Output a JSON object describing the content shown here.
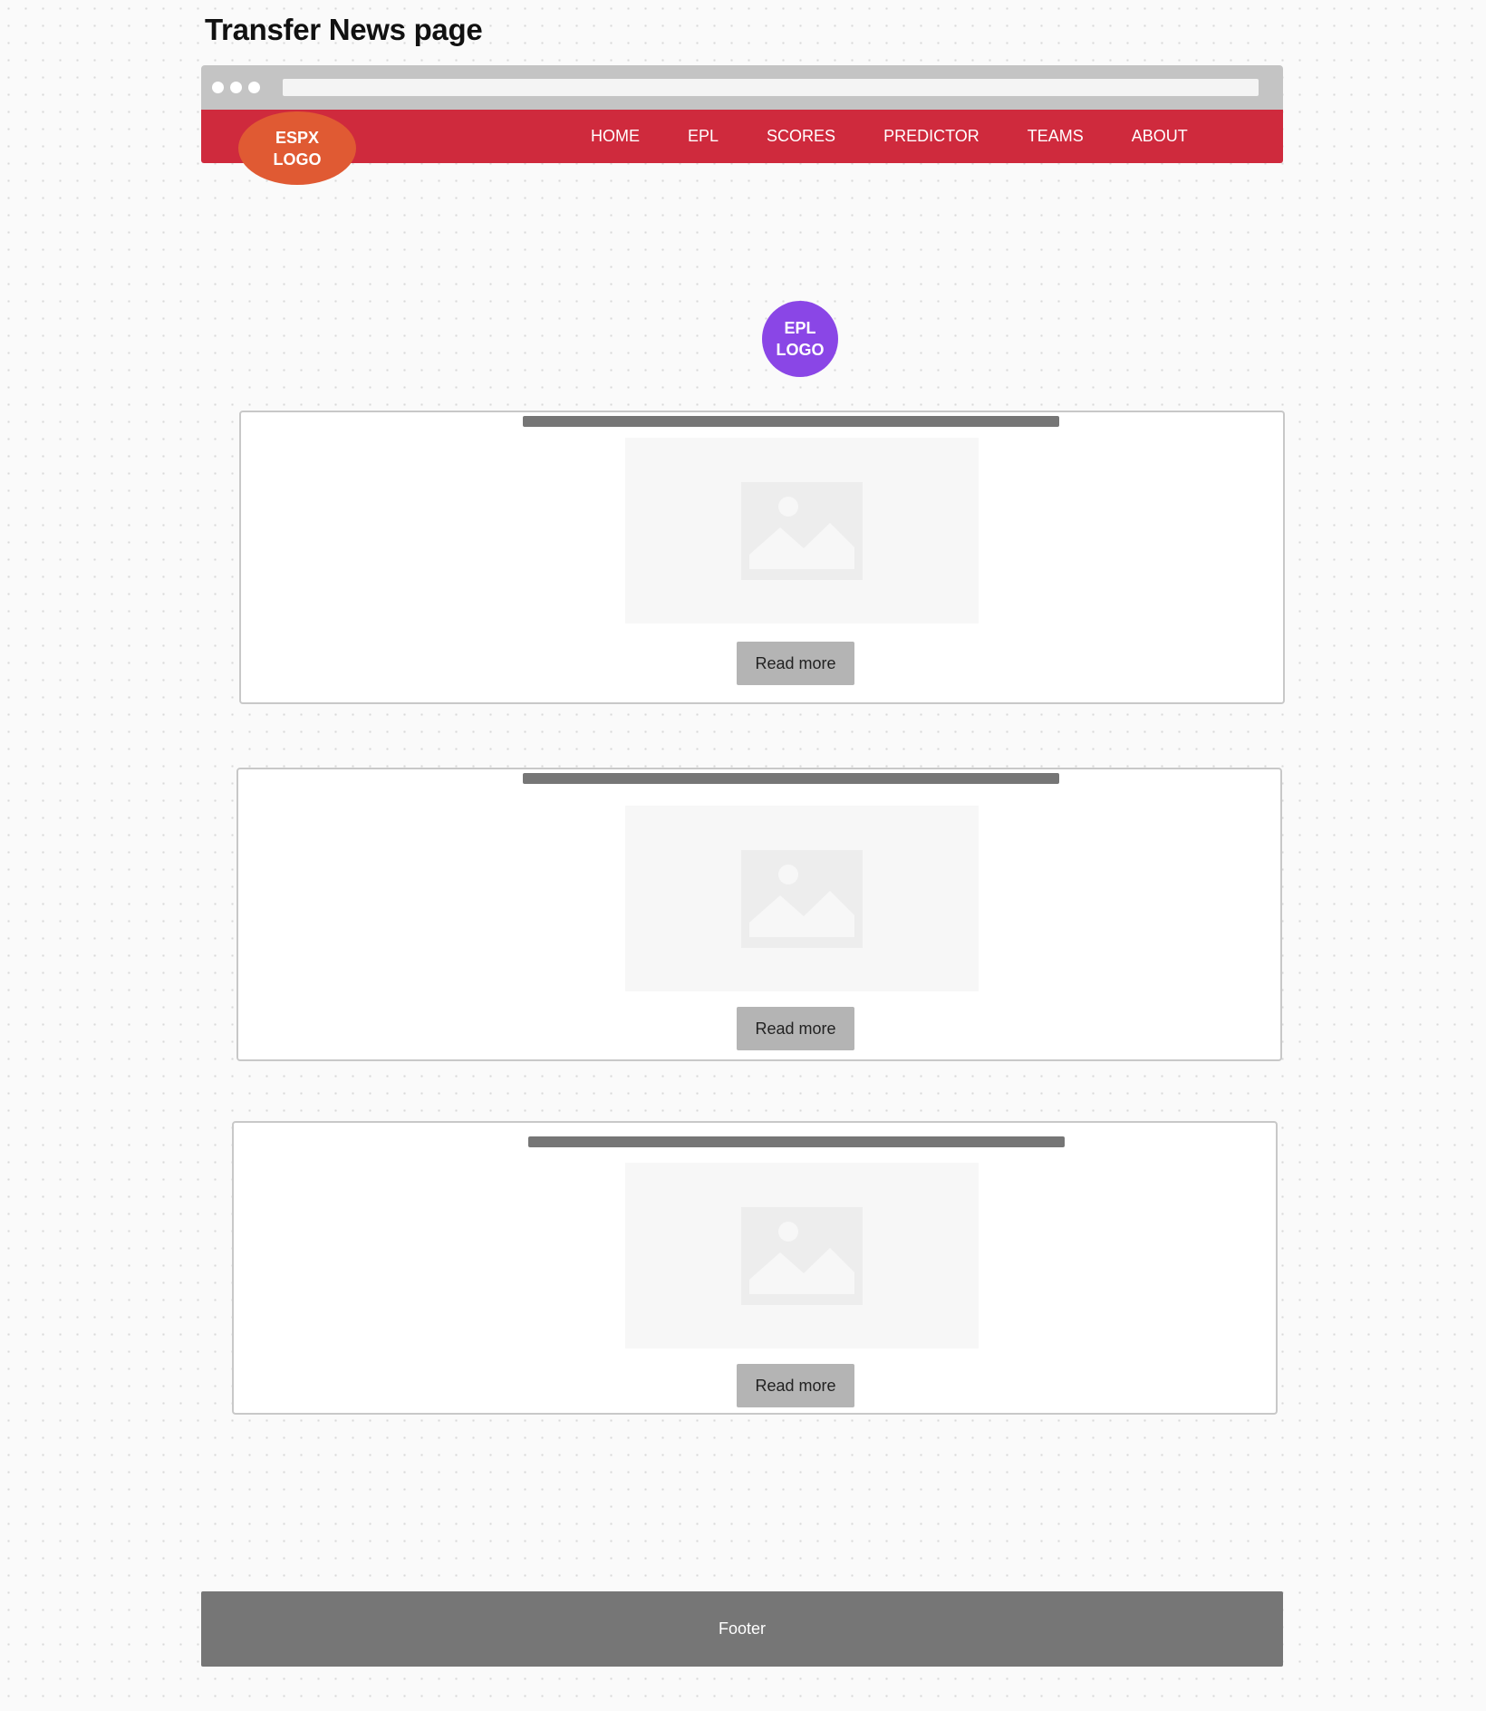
{
  "page": {
    "title": "Transfer News page"
  },
  "browser": {
    "window_dots": 3
  },
  "header": {
    "logo_line1": "ESPX",
    "logo_line2": "LOGO",
    "nav": [
      "HOME",
      "EPL",
      "SCORES",
      "PREDICTOR",
      "TEAMS",
      "ABOUT"
    ]
  },
  "league_logo": {
    "line1": "EPL",
    "line2": "LOGO"
  },
  "news_cards": [
    {
      "headline_placeholder": true,
      "image_icon": "image-placeholder-icon",
      "button_label": "Read more"
    },
    {
      "headline_placeholder": true,
      "image_icon": "image-placeholder-icon",
      "button_label": "Read more"
    },
    {
      "headline_placeholder": true,
      "image_icon": "image-placeholder-icon",
      "button_label": "Read more"
    }
  ],
  "footer": {
    "label": "Footer"
  },
  "colors": {
    "navbar": "#cf2a3d",
    "espx_logo": "#e05a33",
    "epl_logo": "#8a46e6",
    "footer": "#767676",
    "button": "#b4b4b4"
  }
}
